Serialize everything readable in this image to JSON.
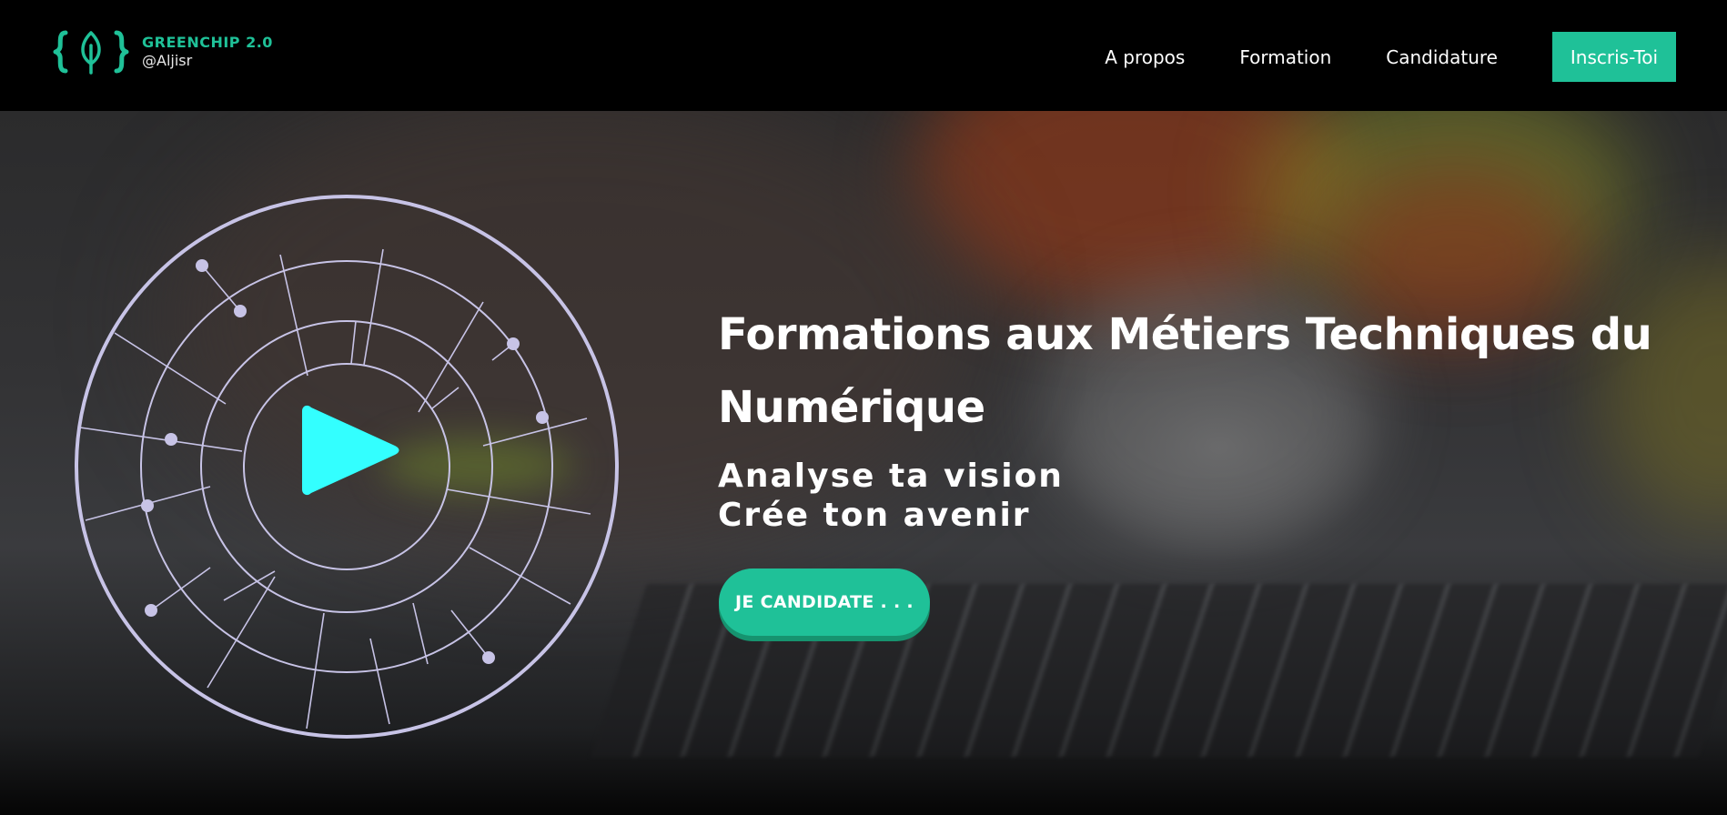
{
  "brand": {
    "title": "GREENCHIP 2.0",
    "handle": "@Aljisr",
    "logo_icon": "leaf-braces-icon",
    "accent_color": "#1fc198"
  },
  "nav": {
    "items": [
      {
        "label": "A propos"
      },
      {
        "label": "Formation"
      },
      {
        "label": "Candidature"
      }
    ],
    "cta_label": "Inscris-Toi"
  },
  "hero": {
    "title": "Formations aux Métiers Techniques du Numérique",
    "subtitle_line1": "Analyse ta vision",
    "subtitle_line2": "Crée ton avenir",
    "cta_label": "JE CANDIDATE . . .",
    "play_icon": "play-icon",
    "play_color": "#33ffff",
    "wheel_color": "#c7c3e6"
  }
}
